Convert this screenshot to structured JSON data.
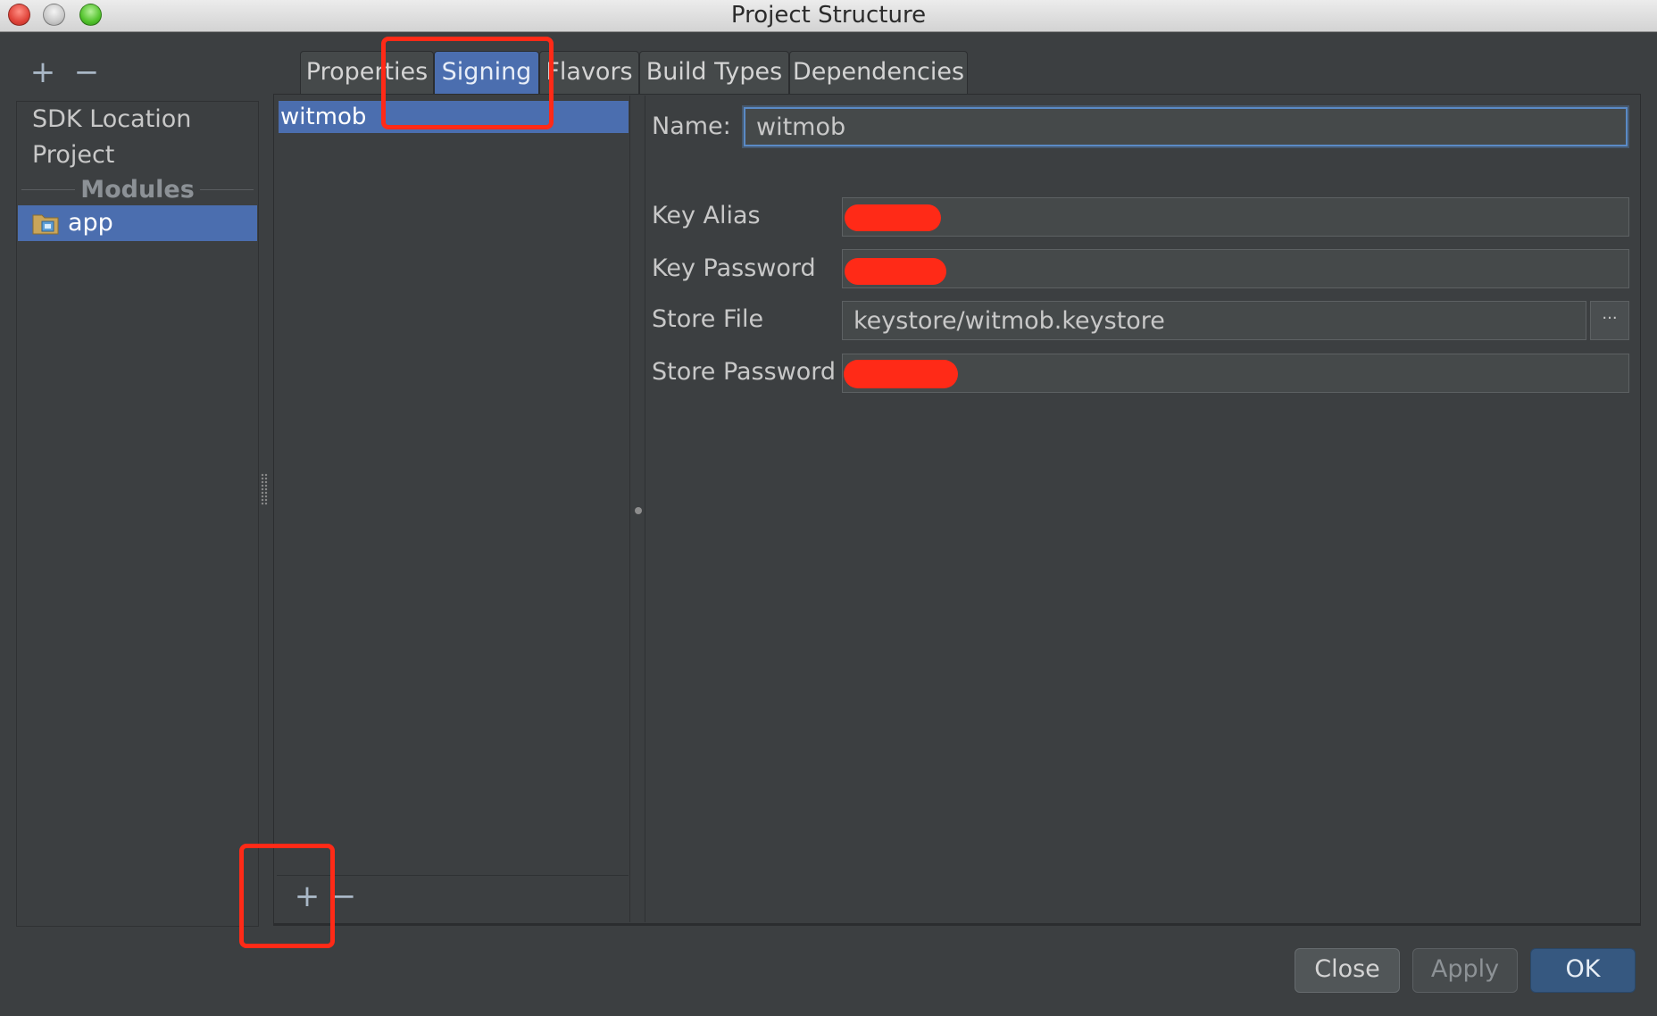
{
  "window": {
    "title": "Project Structure"
  },
  "left_toolbar": {
    "add_glyph": "+",
    "remove_glyph": "−"
  },
  "sidebar": {
    "items": [
      {
        "label": "SDK Location"
      },
      {
        "label": "Project"
      }
    ],
    "section_header": "Modules",
    "modules": [
      {
        "label": "app",
        "icon": "module-folder-icon",
        "selected": true
      }
    ]
  },
  "tabs": [
    {
      "label": "Properties",
      "active": false
    },
    {
      "label": "Signing",
      "active": true
    },
    {
      "label": "Flavors",
      "active": false
    },
    {
      "label": "Build Types",
      "active": false
    },
    {
      "label": "Dependencies",
      "active": false
    }
  ],
  "signing": {
    "configs": [
      {
        "label": "witmob",
        "selected": true
      }
    ],
    "list_toolbar": {
      "add_glyph": "+",
      "remove_glyph": "−"
    },
    "form": {
      "name_label": "Name:",
      "name_value": "witmob",
      "key_alias_label": "Key Alias",
      "key_alias_value": "",
      "key_password_label": "Key Password",
      "key_password_value": "",
      "store_file_label": "Store File",
      "store_file_value": "keystore/witmob.keystore",
      "browse_glyph": "···",
      "store_password_label": "Store Password",
      "store_password_value": ""
    }
  },
  "footer": {
    "close_label": "Close",
    "apply_label": "Apply",
    "ok_label": "OK"
  },
  "colors": {
    "background": "#3c3f41",
    "selection": "#4b6eaf",
    "annotation_red": "#ff2a17",
    "ok_button": "#365880"
  }
}
